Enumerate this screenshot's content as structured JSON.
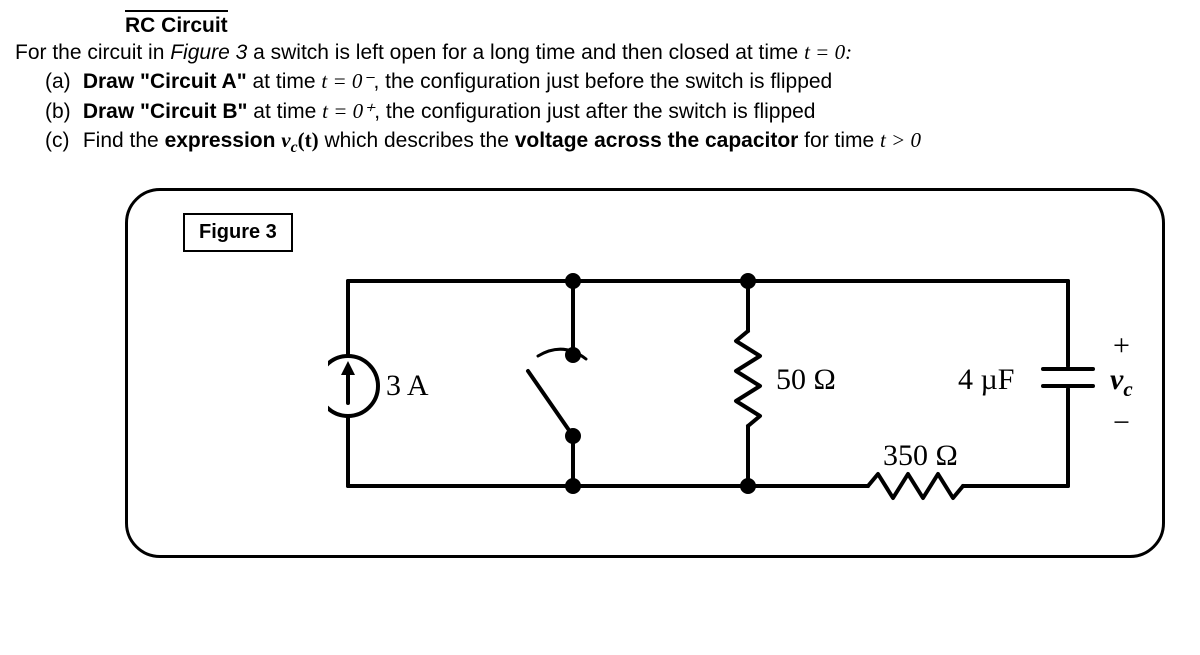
{
  "title": "RC Circuit",
  "intro_prefix": "For the circuit in ",
  "intro_fig": "Figure 3",
  "intro_suffix": " a switch is left open for a long time and then closed at time ",
  "intro_eq": "t = 0:",
  "parts": {
    "a": {
      "label": "(a)",
      "bold": "Draw \"Circuit A\"",
      "mid": " at time ",
      "eq": "t = 0⁻",
      "tail": ", the configuration just before the switch is flipped"
    },
    "b": {
      "label": "(b)",
      "bold": "Draw \"Circuit B\"",
      "mid": " at time ",
      "eq": "t = 0⁺",
      "tail": ", the configuration just after the switch is flipped"
    },
    "c": {
      "label": "(c)",
      "pre": "Find the ",
      "bold1": "expression ",
      "eq": "v",
      "sub": "c",
      "eq2": "(t)",
      "mid": " which describes the ",
      "bold2": "voltage across the capacitor",
      "tail": " for time ",
      "eq3": "t > 0"
    }
  },
  "figure": {
    "label": "Figure 3",
    "source": "3 A",
    "r1": "50 Ω",
    "r2": "350 Ω",
    "cap": "4 µF",
    "vc_plus": "+",
    "vc": "v",
    "vc_sub": "c",
    "vc_minus": "−"
  }
}
